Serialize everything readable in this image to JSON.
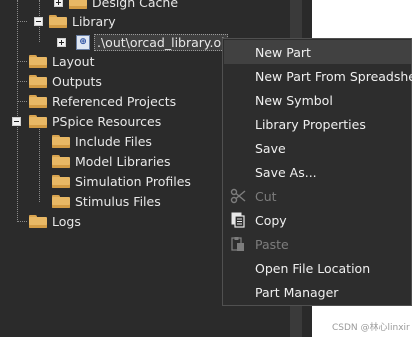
{
  "tree": {
    "design_cache": "Design Cache",
    "library": "Library",
    "library_file": ".\\out\\orcad_library.ol",
    "layout": "Layout",
    "outputs": "Outputs",
    "referenced_projects": "Referenced Projects",
    "pspice_resources": "PSpice Resources",
    "include_files": "Include Files",
    "model_libraries": "Model Libraries",
    "simulation_profiles": "Simulation Profiles",
    "stimulus_files": "Stimulus Files",
    "logs": "Logs"
  },
  "context_menu": {
    "new_part": "New Part",
    "new_part_from_spreadsheet": "New Part From Spreadsheet",
    "new_symbol": "New Symbol",
    "library_properties": "Library Properties",
    "save": "Save",
    "save_as": "Save As...",
    "cut": "Cut",
    "copy": "Copy",
    "paste": "Paste",
    "open_file_location": "Open File Location",
    "part_manager": "Part Manager"
  },
  "watermark": "CSDN @林心linxir"
}
